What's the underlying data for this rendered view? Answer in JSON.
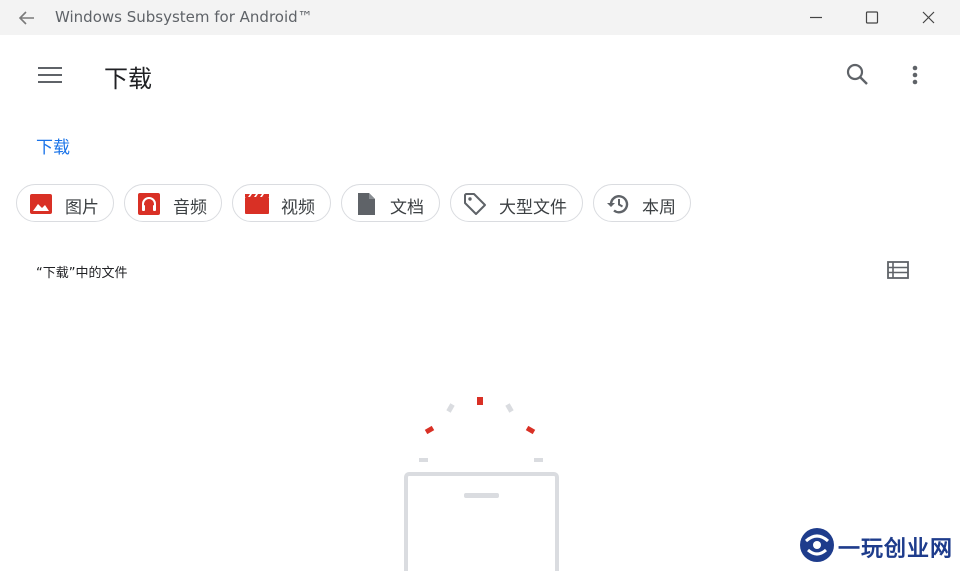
{
  "window": {
    "title": "Windows Subsystem for Android™"
  },
  "appbar": {
    "title": "下载"
  },
  "breadcrumb": {
    "root": "下载"
  },
  "chips": [
    {
      "label": "图片",
      "icon": "image-icon"
    },
    {
      "label": "音频",
      "icon": "headphones-icon"
    },
    {
      "label": "视频",
      "icon": "movie-icon"
    },
    {
      "label": "文档",
      "icon": "document-icon"
    },
    {
      "label": "大型文件",
      "icon": "tag-icon"
    },
    {
      "label": "本周",
      "icon": "history-icon"
    }
  ],
  "section": {
    "label": "“下载”中的文件"
  },
  "colors": {
    "accent": "#1a73e8",
    "chip_icon_red": "#d93025",
    "chip_icon_gray": "#5f6368"
  },
  "watermark": {
    "text": "一玩创业网"
  }
}
